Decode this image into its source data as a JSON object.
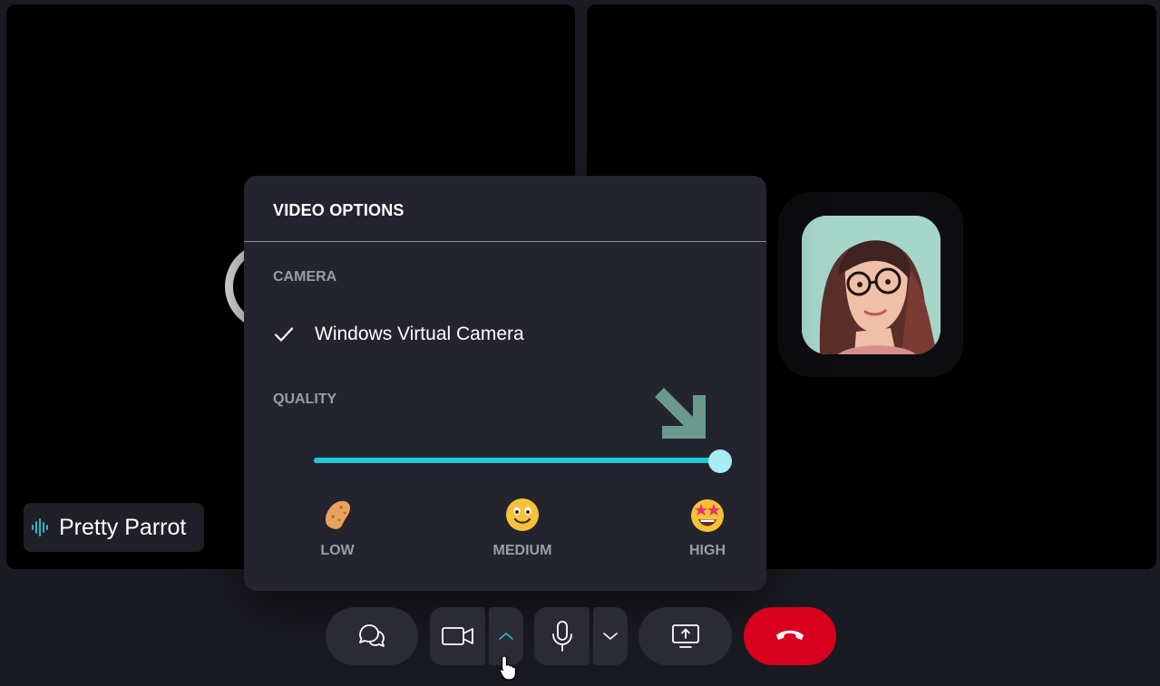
{
  "participants": {
    "local": {
      "name": "Pretty Parrot"
    },
    "remote": {
      "avatar": "woman-with-glasses-avatar"
    }
  },
  "video_options": {
    "title": "VIDEO OPTIONS",
    "camera_section": "CAMERA",
    "camera_selected": "Windows Virtual Camera",
    "quality_section": "QUALITY",
    "quality_level": 1.0,
    "quality_options": [
      {
        "label": "LOW",
        "icon": "potato-emoji-icon"
      },
      {
        "label": "MEDIUM",
        "icon": "smiling-face-emoji-icon"
      },
      {
        "label": "HIGH",
        "icon": "star-struck-emoji-icon"
      }
    ],
    "selected_quality": "HIGH"
  },
  "controls": [
    {
      "name": "chat-button",
      "icon": "chat-bubbles-icon"
    },
    {
      "name": "camera-button",
      "icon": "video-camera-icon"
    },
    {
      "name": "camera-options-button",
      "icon": "chevron-up-icon"
    },
    {
      "name": "microphone-button",
      "icon": "microphone-icon"
    },
    {
      "name": "microphone-options-button",
      "icon": "chevron-down-icon"
    },
    {
      "name": "share-screen-button",
      "icon": "screen-share-icon"
    },
    {
      "name": "end-call-button",
      "icon": "hang-up-icon"
    }
  ],
  "colors": {
    "accent": "#1fc8d8",
    "slider_thumb": "#a8ecf4",
    "end_call": "#d8001c",
    "panel_bg": "#23242e",
    "button_bg": "#2a2b35"
  }
}
